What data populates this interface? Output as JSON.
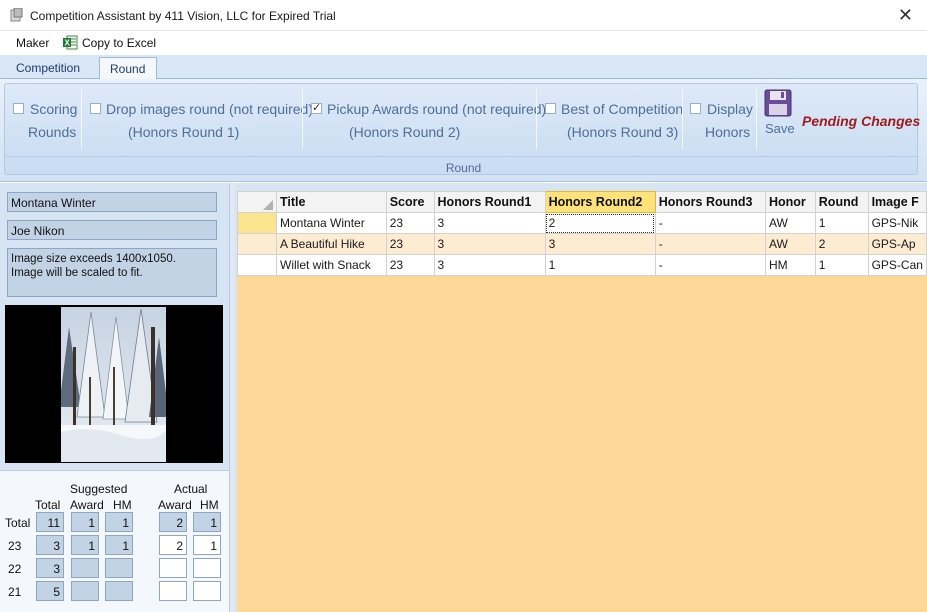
{
  "window": {
    "title": "Competition Assistant by 411 Vision, LLC for Expired Trial",
    "close_glyph": "✕"
  },
  "menu": {
    "items": [
      "Maker",
      "Copy to Excel"
    ]
  },
  "tabs": [
    {
      "label": "Competition",
      "active": false
    },
    {
      "label": "Round",
      "active": true
    }
  ],
  "ribbon": {
    "groups": [
      {
        "line1": "Scoring",
        "line2": "Rounds",
        "checked": false
      },
      {
        "line1": "Drop images round (not required)",
        "line2": "(Honors Round 1)",
        "checked": false
      },
      {
        "line1": "Pickup Awards round (not required)",
        "line2": "(Honors Round 2)",
        "checked": true
      },
      {
        "line1": "Best of Competition",
        "line2": "(Honors Round 3)",
        "checked": false
      },
      {
        "line1": "Display",
        "line2": "Honors",
        "checked": false
      }
    ],
    "save_label": "Save",
    "pending_label": "Pending Changes",
    "group_label": "Round",
    "colors": {
      "pending": "#a01c1c",
      "label": "#4f6f95"
    }
  },
  "left": {
    "image_title": "Montana Winter",
    "maker": "Joe Nikon",
    "message_line1": "Image size exceeds 1400x1050.",
    "message_line2": "Image will be scaled to fit."
  },
  "stats": {
    "headers": {
      "suggested": "Suggested",
      "actual": "Actual",
      "total": "Total",
      "award": "Award",
      "hm": "HM"
    },
    "rows": [
      {
        "label": "Total",
        "total": "11",
        "s_award": "1",
        "s_hm": "1",
        "a_award": "2",
        "a_hm": "1"
      },
      {
        "label": "23",
        "total": "3",
        "s_award": "1",
        "s_hm": "1",
        "a_award": "2",
        "a_hm": "1"
      },
      {
        "label": "22",
        "total": "3",
        "s_award": "",
        "s_hm": "",
        "a_award": "",
        "a_hm": ""
      },
      {
        "label": "21",
        "total": "5",
        "s_award": "",
        "s_hm": "",
        "a_award": "",
        "a_hm": ""
      }
    ]
  },
  "grid": {
    "columns": [
      "Title",
      "Score",
      "Honors Round1",
      "Honors Round2",
      "Honors Round3",
      "Honor",
      "Round",
      "Image F"
    ],
    "selected_column": "Honors Round2",
    "rows": [
      [
        "Montana Winter",
        "23",
        "3",
        "2",
        "-",
        "AW",
        "1",
        "GPS-Nik"
      ],
      [
        "A Beautiful Hike",
        "23",
        "3",
        "3",
        "-",
        "AW",
        "2",
        "GPS-Ap"
      ],
      [
        "Willet with Snack",
        "23",
        "3",
        "1",
        "-",
        "HM",
        "1",
        "GPS-Can"
      ]
    ],
    "colors": {
      "background": "#fdd797",
      "alt_row": "#fdebd2",
      "selected_header": "#fde27a"
    }
  }
}
